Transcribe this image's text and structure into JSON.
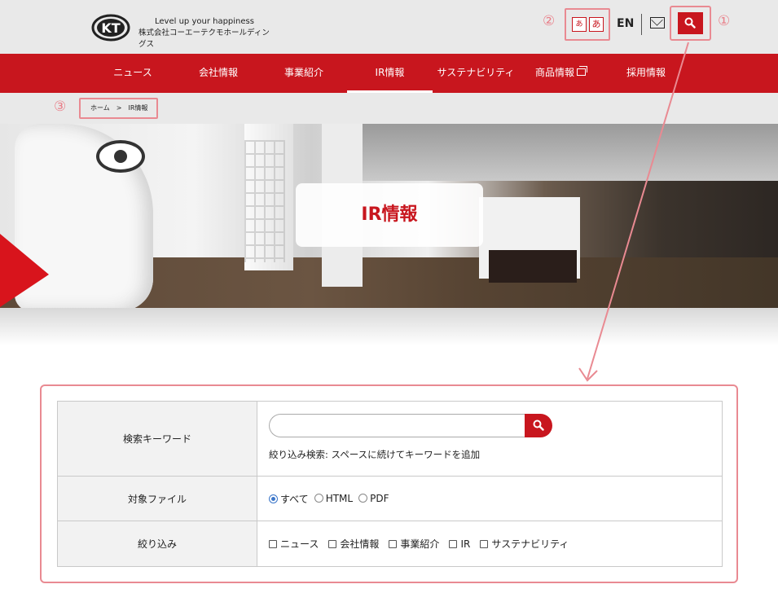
{
  "header": {
    "logo_mark": "KT",
    "logo_tagline": "Level up your happiness",
    "logo_company": "株式会社コーエーテクモホールディングス",
    "font_small": "あ",
    "font_large": "あ",
    "lang": "EN",
    "callouts": [
      "①",
      "②",
      "③"
    ]
  },
  "nav": {
    "items": [
      {
        "label": "ニュース"
      },
      {
        "label": "会社情報"
      },
      {
        "label": "事業紹介"
      },
      {
        "label": "IR情報"
      },
      {
        "label": "サステナビリティ"
      },
      {
        "label": "商品情報"
      },
      {
        "label": "採用情報"
      }
    ]
  },
  "breadcrumb": {
    "text": "ホーム　>　IR情報"
  },
  "hero": {
    "title": "IR情報"
  },
  "search": {
    "keyword_label": "検索キーワード",
    "keyword_value": "",
    "keyword_hint": "絞り込み検索: スペースに続けてキーワードを追加",
    "file_label": "対象ファイル",
    "file_options": [
      {
        "label": "すべて",
        "selected": true
      },
      {
        "label": "HTML",
        "selected": false
      },
      {
        "label": "PDF",
        "selected": false
      }
    ],
    "filter_label": "絞り込み",
    "filter_options": [
      {
        "label": "ニュース"
      },
      {
        "label": "会社情報"
      },
      {
        "label": "事業紹介"
      },
      {
        "label": "IR"
      },
      {
        "label": "サステナビリティ"
      }
    ]
  },
  "colors": {
    "brand_red": "#c8161e",
    "callout_pink": "#e98a92",
    "radio_blue": "#3b76c9"
  }
}
